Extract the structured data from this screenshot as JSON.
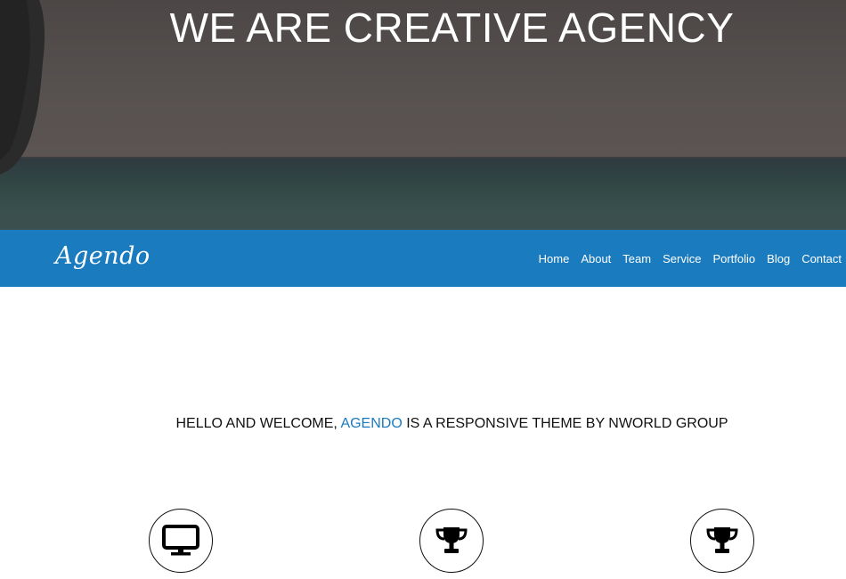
{
  "hero": {
    "title": "WE ARE CREATIVE AGENCY"
  },
  "navbar": {
    "logo": "Agendo",
    "links": [
      "Home",
      "About",
      "Team",
      "Service",
      "Portfolio",
      "Blog",
      "Contact"
    ],
    "background_color": "#1a7bbf"
  },
  "welcome": {
    "prefix": "HELLO AND WELCOME, ",
    "brand": "AGENDO",
    "suffix": " IS A RESPONSIVE THEME BY NWORLD GROUP",
    "brand_color": "#1a7bbf"
  },
  "features": [
    {
      "icon": "monitor-icon"
    },
    {
      "icon": "trophy-icon"
    },
    {
      "icon": "trophy-icon"
    }
  ]
}
